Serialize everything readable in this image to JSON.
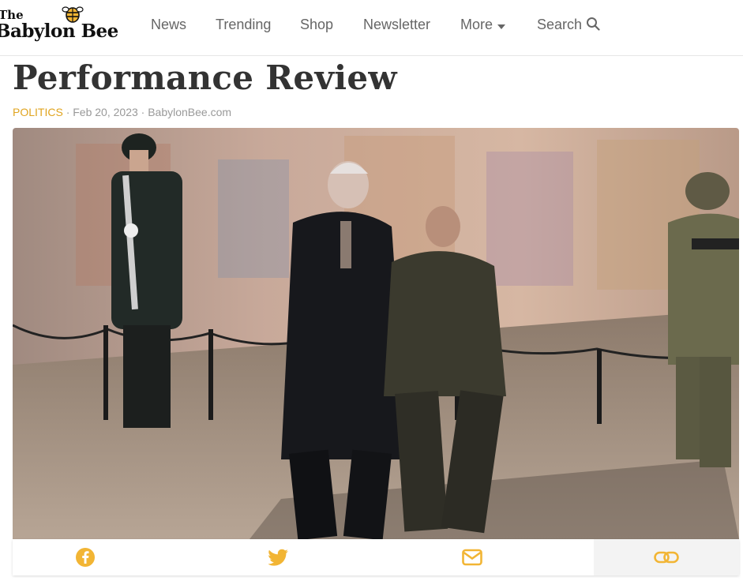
{
  "header": {
    "logo_the": "The",
    "logo_name": "Babylon Bee",
    "nav": [
      "News",
      "Trending",
      "Shop",
      "Newsletter",
      "More",
      "Search"
    ]
  },
  "article": {
    "title": "Performance Review",
    "category": "POLITICS",
    "date": "Feb 20, 2023",
    "source": "BabylonBee.com"
  },
  "colors": {
    "accent": "#e0a41f",
    "share_icon": "#f2b534",
    "nav_text": "#666666"
  },
  "share": {
    "icons": [
      "facebook-icon",
      "twitter-icon",
      "email-icon",
      "link-icon"
    ]
  }
}
